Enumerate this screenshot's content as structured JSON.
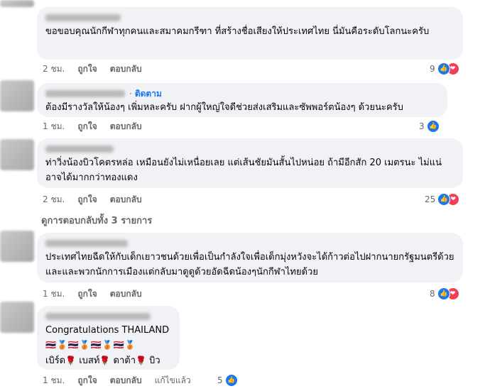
{
  "comments": [
    {
      "text": "ขอขอบคุณนักกีฬาทุกคนและสมาคมกรีฑา ที่สร้างชื่อเสียงให้ประเทศไทย นี่มันคือระดับโลกนะครับ",
      "time": "2 ชม.",
      "like_label": "ถูกใจ",
      "reply_label": "ตอบกลับ",
      "reaction_count": "9"
    },
    {
      "follow_label": "ติดตาม",
      "text": "ต้องมีรางวัลให้น้องๆ เพิ่มหละครับ ฝากผู้ใหญ่ใจดีช่วยส่งเสริมและซัพพอร์ตน้องๆ ด้วยนะครับ",
      "time": "1 ชม.",
      "like_label": "ถูกใจ",
      "reply_label": "ตอบกลับ",
      "reaction_count": "3"
    },
    {
      "text": "ท่าวิ่งน้องบิวโคตรหล่อ เหมือนยังไม่เหนื่อยเลย แต่เส้นชัยมันสั้นไปหน่อย ถ้ามีอีกสัก 20 เมตรนะ ไม่แน่อาจได้มากกว่าทองแดง",
      "time": "2 ชม.",
      "like_label": "ถูกใจ",
      "reply_label": "ตอบกลับ",
      "reaction_count": "25"
    },
    {
      "text": "ประเทศไทยฉีดให้กับเด็กเยาวชนด้วยเพื่อเป็นกำลังใจเพื่อเด็กมุ่งหวังจะได้ก้าวต่อไปฝากนายกรัฐมนตรีด้วยและและพวกนักการเมืองแต่กลับมาดูดูด้วยอัดฉีดน้องๆนักกีฬาไทยด้วย",
      "time": "1 ชม.",
      "like_label": "ถูกใจ",
      "reply_label": "ตอบกลับ",
      "reaction_count": "8"
    },
    {
      "text": "Congratulations THAILAND",
      "flags": "🇹🇭🥉🇹🇭🥉🇹🇭🥉🇹🇭🥉",
      "names": [
        "เบิร์ด",
        "เบสท์",
        "ดาต้า",
        "บิว"
      ],
      "time": "1 ชม.",
      "like_label": "ถูกใจ",
      "reply_label": "ตอบกลับ",
      "edited_label": "แก้ไขแล้ว",
      "reaction_count": "5"
    }
  ],
  "view_replies_label": "ดูการตอบกลับทั้ง 3 รายการ",
  "colors": {
    "link": "#1877f2",
    "like": "#1877f2",
    "love": "#f33e58",
    "bubble": "#f0f2f5"
  },
  "icons": {
    "like": "thumbs-up-icon",
    "love": "heart-icon",
    "rose": "rose-icon"
  }
}
